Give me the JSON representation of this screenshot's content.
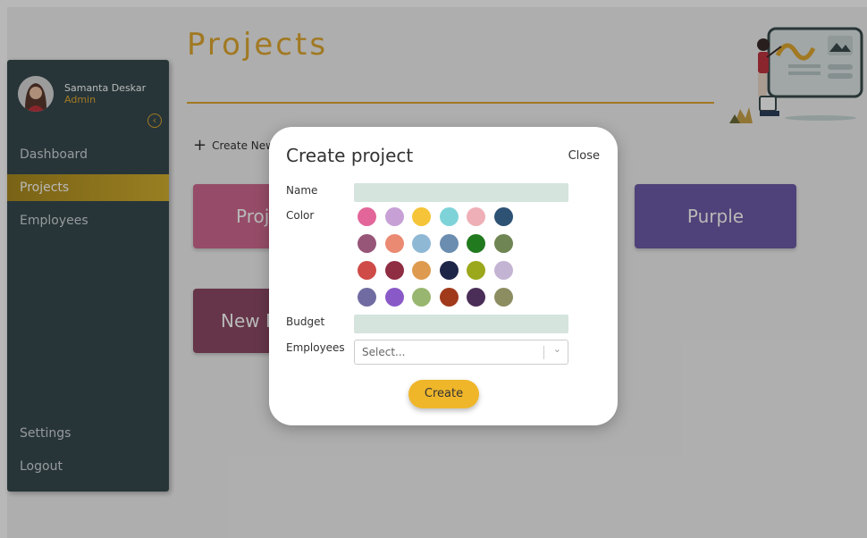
{
  "page": {
    "title": "Projects",
    "create_new_label": "Create New P"
  },
  "user": {
    "name": "Samanta Deskar",
    "role": "Admin"
  },
  "nav": {
    "items": [
      {
        "label": "Dashboard"
      },
      {
        "label": "Projects",
        "active": true
      },
      {
        "label": "Employees"
      }
    ],
    "bottom_items": [
      {
        "label": "Settings"
      },
      {
        "label": "Logout"
      }
    ]
  },
  "cards": [
    {
      "label": "Proj",
      "color": "#d06a90"
    },
    {
      "label": "New P",
      "color": "#8e4a66"
    },
    {
      "label": "Purple",
      "color": "#6e5ba8"
    }
  ],
  "modal": {
    "title": "Create project",
    "close_label": "Close",
    "name_label": "Name",
    "color_label": "Color",
    "budget_label": "Budget",
    "employees_label": "Employees",
    "employees_placeholder": "Select...",
    "create_label": "Create",
    "colors": [
      "#e26699",
      "#c7a1d6",
      "#f6c438",
      "#7ed3d8",
      "#eeb0b6",
      "#2d5274",
      "#975577",
      "#ea8a72",
      "#8fb8d5",
      "#6a8db0",
      "#227a1f",
      "#6f8553",
      "#cf4b48",
      "#8f2d42",
      "#de9a4e",
      "#1e2648",
      "#9ba81b",
      "#c4b4d3",
      "#706ca2",
      "#8a59c8",
      "#98b66f",
      "#a03a1b",
      "#4a2e57",
      "#8c8d61"
    ]
  },
  "theme": {
    "accent": "#e0a830",
    "sidebar_bg": "#364a4f"
  }
}
